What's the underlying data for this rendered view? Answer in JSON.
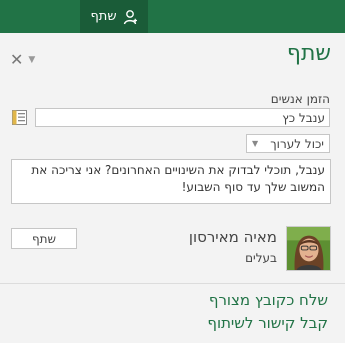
{
  "topbar": {
    "share_tab_label": "שתף",
    "share_tab_icon": "person-icon",
    "colors": {
      "bar": "#217346",
      "tab": "#1a5c38"
    }
  },
  "panel": {
    "title": "שתף",
    "close_icon": "close-icon",
    "options_icon": "chevron-down-icon",
    "invite_label": "הזמן אנשים",
    "invite_value": "ענבל כץ",
    "addressbook_icon": "address-book-icon",
    "permission_selected": "יכול לערוך",
    "message": "ענבל, תוכלי לבדוק את השינויים האחרונים? אני צריכה את המשוב שלך עד סוף השבוע!",
    "share_button": "שתף",
    "owner": {
      "name": "מאיה מאירסון",
      "role": "בעלים",
      "avatar_icon": "avatar-photo"
    },
    "links": {
      "send_attachment": "שלח כקובץ מצורף",
      "get_link": "קבל קישור לשיתוף"
    },
    "colors": {
      "accent": "#217346",
      "panel_bg": "#f3f3f3"
    }
  }
}
